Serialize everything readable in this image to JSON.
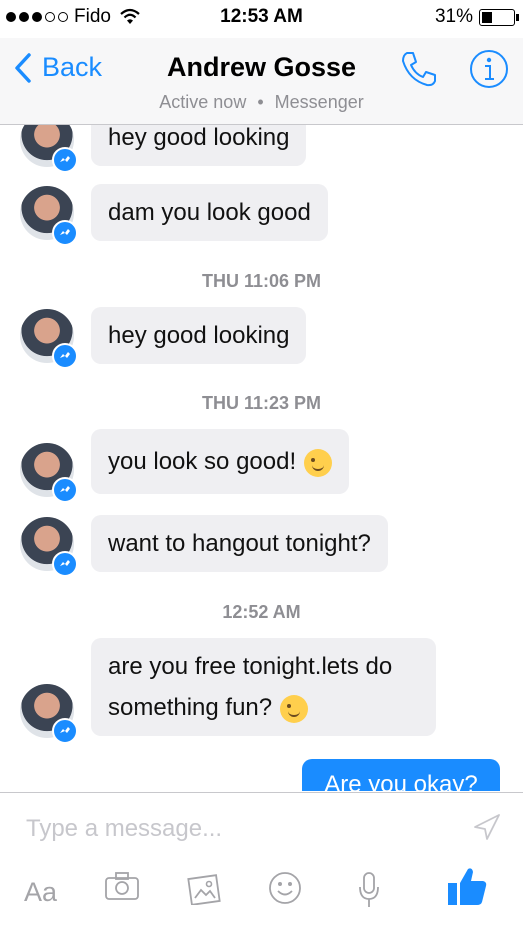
{
  "status": {
    "carrier": "Fido",
    "time": "12:53 AM",
    "battery": "31%"
  },
  "header": {
    "back_label": "Back",
    "title": "Andrew Gosse",
    "subtitle_active": "Active now",
    "subtitle_separator": "•",
    "subtitle_app": "Messenger"
  },
  "messages": [
    {
      "text": "hey good looking"
    },
    {
      "text": "dam you look good"
    },
    {
      "timestamp": "THU 11:06 PM"
    },
    {
      "text": "hey good looking"
    },
    {
      "timestamp": "THU 11:23 PM"
    },
    {
      "text": "you look so good!",
      "emoji": "wink-emoji"
    },
    {
      "text": "want to hangout tonight?"
    },
    {
      "timestamp": "12:52 AM"
    },
    {
      "line1": "are you free tonight.lets do",
      "line2": "something fun?",
      "emoji": "wink-emoji"
    },
    {
      "text": "Are you okay?",
      "outgoing": true
    }
  ],
  "composer": {
    "placeholder": "Type a message...",
    "font_label": "Aa"
  },
  "colors": {
    "accent": "#1a8cff",
    "bubble_in": "#efeff2",
    "muted": "#8e8e93"
  }
}
